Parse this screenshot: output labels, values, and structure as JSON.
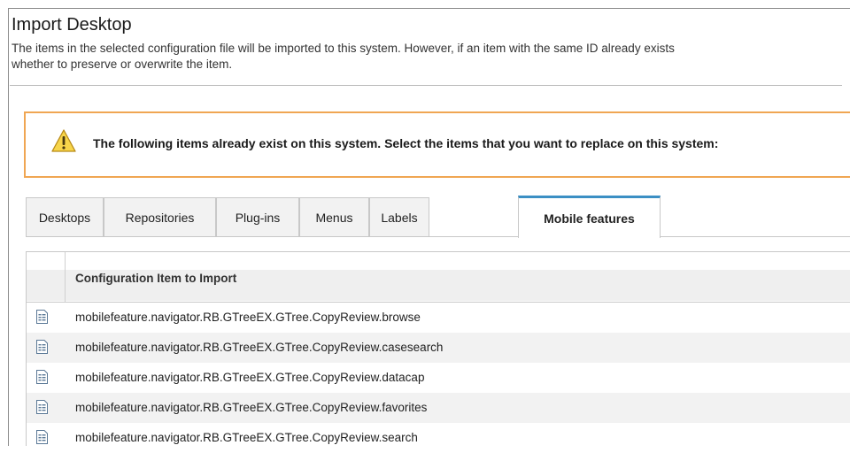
{
  "page": {
    "title": "Import Desktop",
    "description_line1": "The items in the selected configuration file will be imported to this system. However, if an item with the same ID already exists",
    "description_line2": "whether to preserve or overwrite the item."
  },
  "warning": {
    "icon": "warning-triangle-icon",
    "message": "The following items already exist on this system. Select the items that you want to replace on this system:"
  },
  "tabs": [
    {
      "label": "Desktops"
    },
    {
      "label": "Repositories"
    },
    {
      "label": "Plug-ins"
    },
    {
      "label": "Menus"
    },
    {
      "label": "Labels"
    },
    {
      "label": "Mobile features",
      "active": true
    }
  ],
  "grid": {
    "column_header": "Configuration Item to Import",
    "row_icon": "document-icon",
    "rows": [
      {
        "item": "mobilefeature.navigator.RB.GTreeEX.GTree.CopyReview.browse"
      },
      {
        "item": "mobilefeature.navigator.RB.GTreeEX.GTree.CopyReview.casesearch"
      },
      {
        "item": "mobilefeature.navigator.RB.GTreeEX.GTree.CopyReview.datacap"
      },
      {
        "item": "mobilefeature.navigator.RB.GTreeEX.GTree.CopyReview.favorites"
      },
      {
        "item": "mobilefeature.navigator.RB.GTreeEX.GTree.CopyReview.search"
      }
    ]
  },
  "colors": {
    "warning_border": "#f0a653",
    "active_tab_accent": "#3b8fc4",
    "row_alt_background": "#f2f2f2"
  }
}
